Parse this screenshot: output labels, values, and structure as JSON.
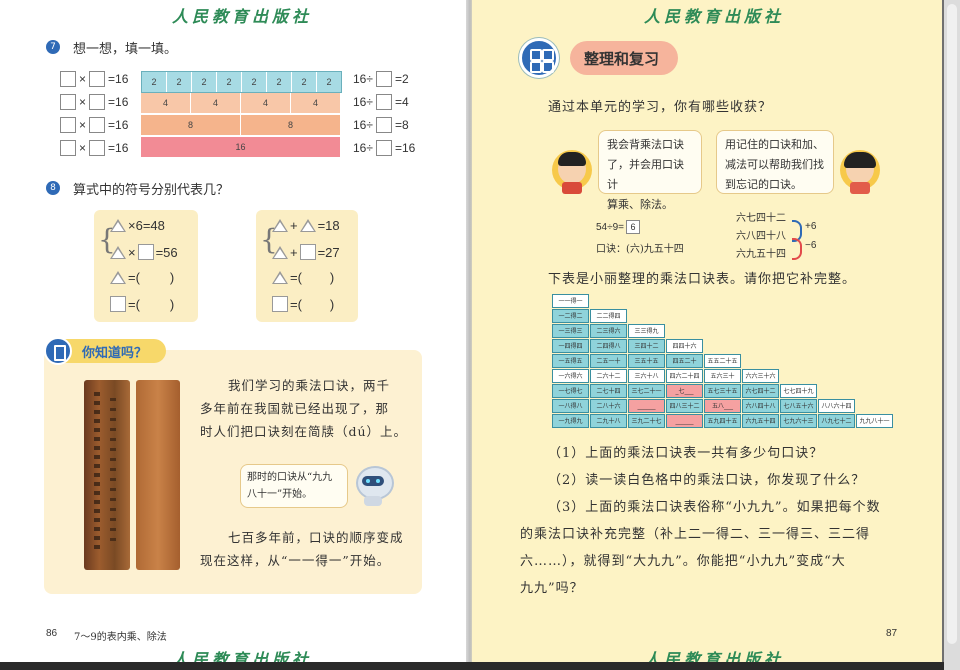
{
  "publisher": "人民教育出版社",
  "left_page": {
    "q7": {
      "num": "7",
      "text": "想一想，填一填。",
      "rows": [
        {
          "mult_result": "=16",
          "div": "16÷",
          "div_result": "=2"
        },
        {
          "mult_result": "=16",
          "div": "16÷",
          "div_result": "=4"
        },
        {
          "mult_result": "=16",
          "div": "16÷",
          "div_result": "=8"
        },
        {
          "mult_result": "=16",
          "div": "16÷",
          "div_result": "=16"
        }
      ],
      "bars": [
        [
          "2",
          "2",
          "2",
          "2",
          "2",
          "2",
          "2",
          "2"
        ],
        [
          "4",
          "4",
          "4",
          "4"
        ],
        [
          "8",
          "8"
        ],
        [
          "16"
        ]
      ],
      "times": "×"
    },
    "q8": {
      "num": "8",
      "text": "算式中的符号分别代表几？",
      "card1": [
        "×6=48",
        "×",
        "=56",
        "=(",
        ")",
        "=(",
        ")"
      ],
      "card2": [
        "+",
        "=18",
        "+",
        "=27",
        "=(",
        ")",
        "=(",
        ")"
      ]
    },
    "did_you_know": {
      "title": "你知道吗？",
      "para1": [
        "我们学习的乘法口诀，两千",
        "多年前在我国就已经出现了，那",
        "时人们把口诀刻在简牍（dú）上。"
      ],
      "bubble": [
        "那时的口诀从“九九",
        "八十一”开始。"
      ],
      "para2": [
        "七百多年前，口诀的顺序变成",
        "现在这样，从“一一得一”开始。"
      ]
    },
    "footer_num": "86",
    "footer_title": "7～9的表内乘、除法"
  },
  "right_page": {
    "section_title": "整理和复习",
    "intro": "通过本单元的学习，你有哪些收获？",
    "bubble_left": [
      "我会背乘法口诀",
      "了，并会用口诀计",
      "算乘、除法。"
    ],
    "bubble_right": [
      "用记住的口诀和加、",
      "减法可以帮助我们找",
      "到忘记的口诀。"
    ],
    "example": {
      "eq": "54÷9=",
      "answer": "6",
      "koujue": "口诀：(六)九五十四",
      "lines": [
        "六七四十二",
        "六八四十八",
        "六九五十四"
      ],
      "plus": "+6",
      "minus": "−6"
    },
    "table_intro": "下表是小丽整理的乘法口诀表。请你把它补完整。",
    "table": [
      [
        "一一得一"
      ],
      [
        "一二得二",
        "二二得四"
      ],
      [
        "一三得三",
        "二三得六",
        "三三得九"
      ],
      [
        "一四得四",
        "二四得八",
        "三四十二",
        "四四十六"
      ],
      [
        "一五得五",
        "二五一十",
        "三五十五",
        "四五二十",
        "五五二十五"
      ],
      [
        "一六得六",
        "二六十二",
        "三六十八",
        "四六二十四",
        "五六三十",
        "六六三十六"
      ],
      [
        "一七得七",
        "二七十四",
        "三七二十一",
        "_七___",
        "五七三十五",
        "六七四十二",
        "七七四十九"
      ],
      [
        "一八得八",
        "二八十六",
        "______",
        "四八三十二",
        "五八___",
        "六八四十八",
        "七八五十六",
        "八八六十四"
      ],
      [
        "一九得九",
        "二九十八",
        "三九二十七",
        "______",
        "五九四十五",
        "六九五十四",
        "七九六十三",
        "八九七十二",
        "九九八十一"
      ]
    ],
    "questions": [
      "（1）上面的乘法口诀表一共有多少句口诀？",
      "（2）读一读白色格中的乘法口诀，你发现了什么？",
      "（3）上面的乘法口诀表俗称“小九九”。如果把每个数",
      "的乘法口诀补充完整（补上二一得二、三一得三、三二得",
      "六……），就得到“大九九”。你能把“小九九”变成“大",
      "九九”吗？"
    ],
    "footer_num": "87"
  }
}
